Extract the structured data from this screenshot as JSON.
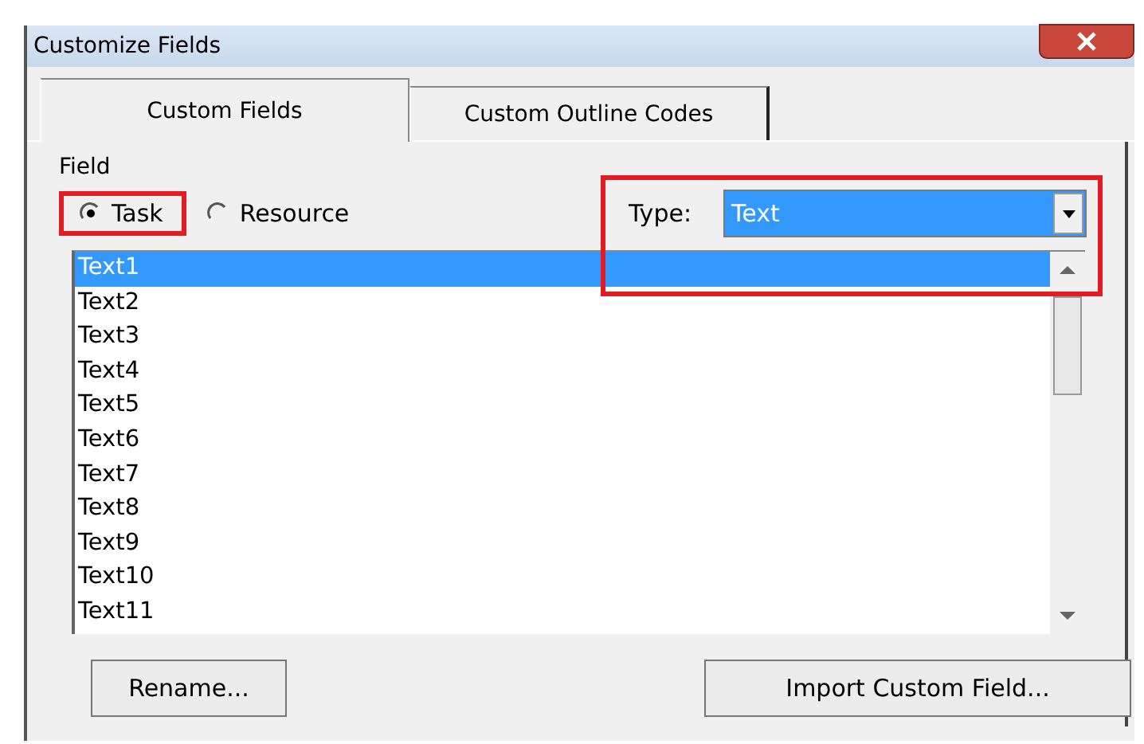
{
  "window": {
    "title": "Customize Fields"
  },
  "tabs": [
    {
      "label": "Custom Fields",
      "selected": true
    },
    {
      "label": "Custom Outline Codes",
      "selected": false
    }
  ],
  "field_group": {
    "label": "Field",
    "options": [
      {
        "label": "Task",
        "selected": true,
        "highlighted": true
      },
      {
        "label": "Resource",
        "selected": false,
        "highlighted": false
      }
    ],
    "type": {
      "label": "Type:",
      "value": "Text",
      "highlighted": true
    }
  },
  "fields_list": [
    {
      "label": "Text1",
      "selected": true
    },
    {
      "label": "Text2",
      "selected": false
    },
    {
      "label": "Text3",
      "selected": false
    },
    {
      "label": "Text4",
      "selected": false
    },
    {
      "label": "Text5",
      "selected": false
    },
    {
      "label": "Text6",
      "selected": false
    },
    {
      "label": "Text7",
      "selected": false
    },
    {
      "label": "Text8",
      "selected": false
    },
    {
      "label": "Text9",
      "selected": false
    },
    {
      "label": "Text10",
      "selected": false
    },
    {
      "label": "Text11",
      "selected": false
    }
  ],
  "buttons": [
    "Rename...",
    "Import Custom Field..."
  ]
}
